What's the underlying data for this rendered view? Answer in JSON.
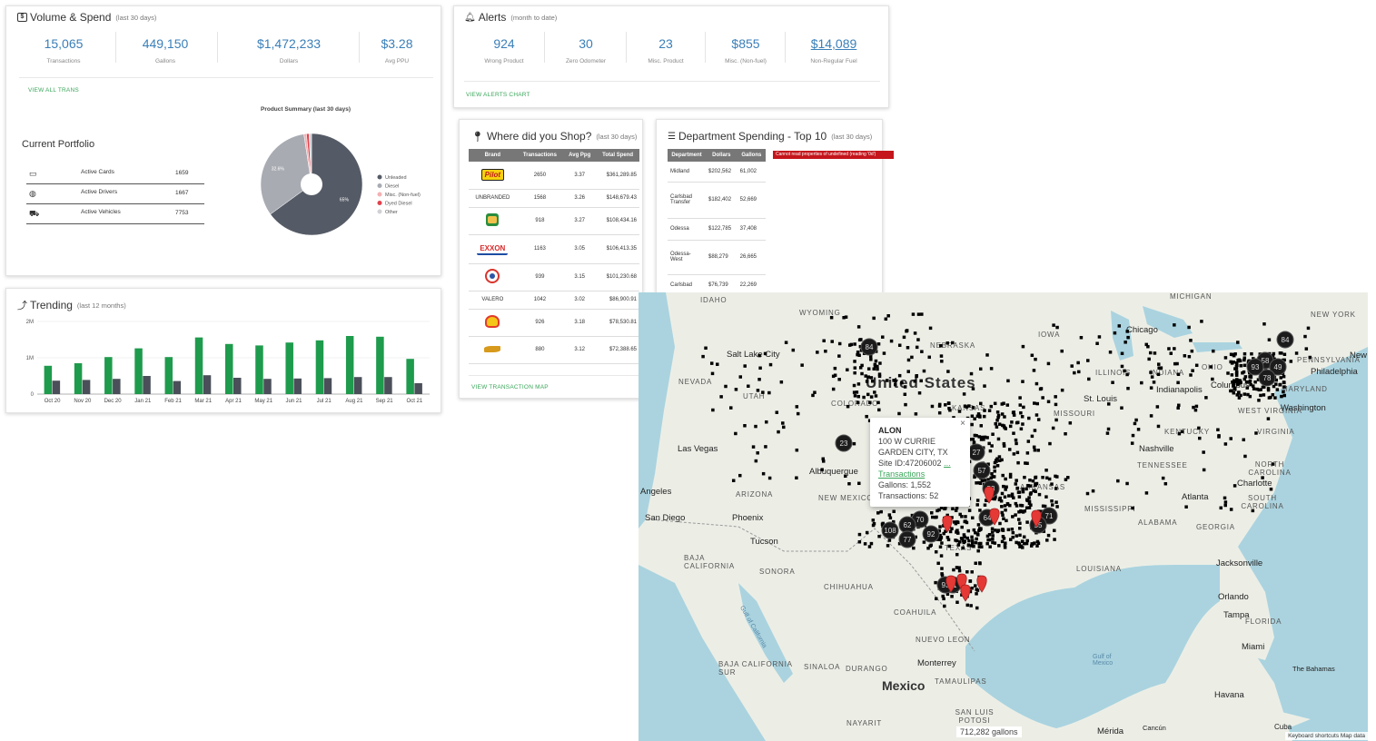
{
  "volume": {
    "title": "Volume & Spend",
    "subtitle": "(last 30 days)",
    "icon": "dollar-icon",
    "kpis": [
      {
        "value": "15,065",
        "label": "Transactions"
      },
      {
        "value": "449,150",
        "label": "Gallons"
      },
      {
        "value": "$1,472,233",
        "label": "Dollars"
      },
      {
        "value": "$3.28",
        "label": "Avg PPU"
      }
    ],
    "link": "VIEW ALL TRANS"
  },
  "alerts": {
    "title": "Alerts",
    "subtitle": "(month to date)",
    "icon": "bell-icon",
    "kpis": [
      {
        "value": "924",
        "label": "Wrong Product"
      },
      {
        "value": "30",
        "label": "Zero Odometer"
      },
      {
        "value": "23",
        "label": "Misc. Product"
      },
      {
        "value": "$855",
        "label": "Misc. (Non-fuel)"
      },
      {
        "value": "$14,089",
        "label": "Non-Regular Fuel"
      }
    ],
    "link": "VIEW ALERTS CHART"
  },
  "portfolio": {
    "title": "Current Portfolio",
    "rows": [
      {
        "icon": "card-icon",
        "label": "Active Cards",
        "value": "1659"
      },
      {
        "icon": "driver-icon",
        "label": "Active Drivers",
        "value": "1667"
      },
      {
        "icon": "car-icon",
        "label": "Active Vehicles",
        "value": "7753"
      }
    ]
  },
  "chart_data": [
    {
      "type": "pie",
      "title": "Product Summary (last 30 days)",
      "slices": [
        {
          "name": "Unleaded",
          "value": 65,
          "color": "#555b66",
          "label": "65%"
        },
        {
          "name": "Diesel",
          "value": 32.6,
          "color": "#a8abb2",
          "label": "32.6%"
        },
        {
          "name": "Misc. (Non-fuel)",
          "value": 0.8,
          "color": "#f3b1b4"
        },
        {
          "name": "Dyed Diesel",
          "value": 0.8,
          "color": "#e0434e"
        },
        {
          "name": "Other",
          "value": 0.8,
          "color": "#cfd1d4"
        }
      ]
    },
    {
      "type": "bar",
      "title": "Trending",
      "subtitle": "(last 12 months)",
      "categories": [
        "Oct 20",
        "Nov 20",
        "Dec 20",
        "Jan 21",
        "Feb 21",
        "Mar 21",
        "Apr 21",
        "May 21",
        "Jun 21",
        "Jul 21",
        "Aug 21",
        "Sep 21",
        "Oct 21"
      ],
      "yticks": [
        {
          "v": 0,
          "label": "0"
        },
        {
          "v": 1000000,
          "label": "1M"
        },
        {
          "v": 2000000,
          "label": "2M"
        }
      ],
      "ylim": [
        0,
        2000000
      ],
      "series": [
        {
          "color": "#1e9b4c",
          "values": [
            780000,
            850000,
            1020000,
            1260000,
            1020000,
            1560000,
            1380000,
            1340000,
            1420000,
            1480000,
            1600000,
            1580000,
            970000
          ]
        },
        {
          "color": "#4a4f59",
          "values": [
            370000,
            390000,
            420000,
            500000,
            360000,
            520000,
            450000,
            420000,
            430000,
            440000,
            470000,
            470000,
            300000
          ]
        }
      ]
    }
  ],
  "trending": {
    "title": "Trending",
    "subtitle": "(last 12 months)",
    "icon": "trending-icon"
  },
  "shop": {
    "title": "Where did you Shop?",
    "subtitle": "(last 30 days)",
    "icon": "map-pin-icon",
    "columns": [
      "Brand",
      "Transactions",
      "Avg Ppg",
      "Total Spend"
    ],
    "rows": [
      {
        "brand": "Pilot",
        "logo": "pilot",
        "tx": "2650",
        "ppg": "3.37",
        "spend": "$361,289.85"
      },
      {
        "brand": "UNBRANDED",
        "logo": "text",
        "tx": "1568",
        "ppg": "3.26",
        "spend": "$148,679.43"
      },
      {
        "brand": "Sinclair",
        "logo": "sinclair",
        "tx": "918",
        "ppg": "3.27",
        "spend": "$108,434.16"
      },
      {
        "brand": "EXXON",
        "logo": "exxon",
        "tx": "1163",
        "ppg": "3.05",
        "spend": "$106,413.35"
      },
      {
        "brand": "Alon",
        "logo": "alon",
        "tx": "939",
        "ppg": "3.15",
        "spend": "$101,230.68"
      },
      {
        "brand": "VALERO",
        "logo": "text",
        "tx": "1042",
        "ppg": "3.02",
        "spend": "$86,900.91"
      },
      {
        "brand": "Shell",
        "logo": "shell",
        "tx": "926",
        "ppg": "3.18",
        "spend": "$78,530.81"
      },
      {
        "brand": "Other",
        "logo": "other",
        "tx": "880",
        "ppg": "3.12",
        "spend": "$72,388.65"
      }
    ],
    "link": "VIEW TRANSACTION MAP"
  },
  "dept": {
    "title": "Department Spending - Top 10",
    "subtitle": "(last 30 days)",
    "icon": "list-icon",
    "columns": [
      "Department",
      "Dollars",
      "Gallons"
    ],
    "rows": [
      {
        "name": "Midland",
        "dollars": "$202,562",
        "gallons": "61,002"
      },
      {
        "name": "Carlsbad Transfer",
        "dollars": "$182,402",
        "gallons": "52,669"
      },
      {
        "name": "Odessa",
        "dollars": "$122,785",
        "gallons": "37,408"
      },
      {
        "name": "Odessa-West",
        "dollars": "$88,279",
        "gallons": "26,665"
      },
      {
        "name": "Carlsbad",
        "dollars": "$76,739",
        "gallons": "22,269"
      }
    ],
    "error": "Cannot read properties of undefined (reading '0d')"
  },
  "map": {
    "country": "United States",
    "country_2": "Mexico",
    "gulf": "Gulf of Mexico",
    "gulf_ca": "Gulf of California",
    "states": [
      "IDAHO",
      "WYOMING",
      "NEBRASKA",
      "IOWA",
      "MICHIGAN",
      "NEW YORK",
      "NEVADA",
      "UTAH",
      "COLORADO",
      "KANSAS",
      "MISSOURI",
      "ILLINOIS",
      "INDIANA",
      "OHIO",
      "KENTUCKY",
      "VIRGINIA",
      "TENNESSEE",
      "NORTH CAROLINA",
      "SOUTH CAROLINA",
      "ARIZONA",
      "NEW MEXICO",
      "ARKANSAS",
      "MISSISSIPPI",
      "ALABAMA",
      "GEORGIA",
      "TEXAS",
      "LOUISIANA",
      "FLORIDA",
      "SONORA",
      "CHIHUAHUA",
      "COAHUILA",
      "NUEVO LEON",
      "BAJA CALIFORNIA",
      "BAJA CALIFORNIA SUR",
      "SINALOA",
      "DURANGO",
      "TAMAULIPAS",
      "SAN LUIS POTOSI",
      "NAYARIT",
      "MARYLAND",
      "PENNSYLVANIA",
      "WEST VIRGINIA"
    ],
    "cities": [
      "Chicago",
      "Salt Lake City",
      "St. Louis",
      "Indianapolis",
      "Columbus",
      "Philadelphia",
      "Washington",
      "Las Vegas",
      "Albuquerque",
      "Nashville",
      "Charlotte",
      "Atlanta",
      "Phoenix",
      "San Diego",
      "Angeles",
      "Tucson",
      "Jacksonville",
      "Orlando",
      "Tampa",
      "Miami",
      "Monterrey",
      "Havana",
      "The Bahamas",
      "Mérida",
      "Cancún",
      "Cuba",
      "New"
    ],
    "popup": {
      "name": "ALON",
      "address1": "100 W CURRIE",
      "address2": "GARDEN CITY, TX",
      "site": "Site ID:47206002",
      "dash": "...",
      "link": "Transactions",
      "gallons": "Gallons: 1,552",
      "transactions": "Transactions: 52",
      "close": "×"
    },
    "cluster_numbers": [
      "84",
      "58",
      "49",
      "78",
      "93",
      "84",
      "27",
      "57",
      "53",
      "71",
      "55",
      "70",
      "62",
      "77",
      "108",
      "92",
      "91",
      "93",
      "64",
      "23"
    ],
    "total": "712,282 gallons",
    "attribution": "Keyboard shortcuts   Map data"
  }
}
